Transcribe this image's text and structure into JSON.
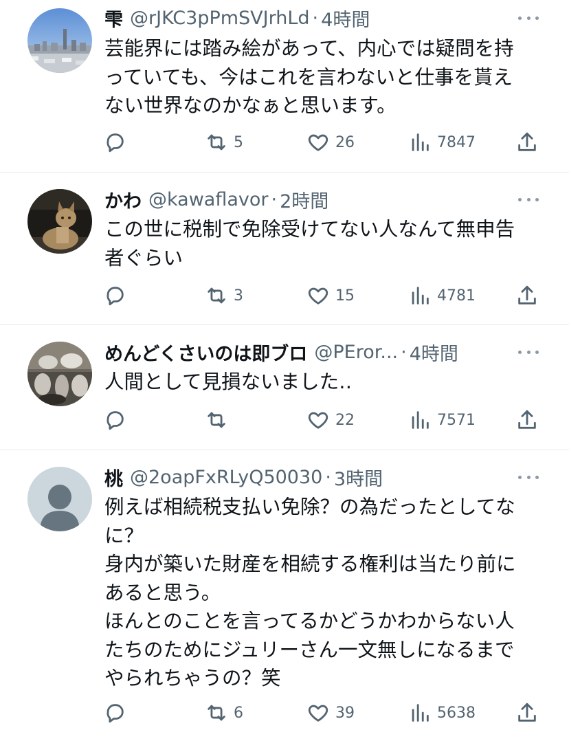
{
  "replies": [
    {
      "name": "雫",
      "handle": "@rJKC3pPmSVJrhLd",
      "time": "4時間",
      "avatar_icon": "cityscape-avatar",
      "text_lines": [
        "芸能界には踏み絵があって、内心では疑問を持",
        "っていても、今はこれを言わないと仕事を貰え",
        "ない世界なのかなぁと思います。"
      ],
      "retweets": "5",
      "likes": "26",
      "views": "7847"
    },
    {
      "name": "かわ",
      "handle": "@kawaflavor",
      "time": "2時間",
      "avatar_icon": "cat-avatar",
      "text_lines": [
        "この世に税制で免除受けてない人なんて無申告",
        "者ぐらい"
      ],
      "retweets": "3",
      "likes": "15",
      "views": "4781"
    },
    {
      "name": "めんどくさいのは即ブロ",
      "handle": "@PEror...",
      "time": "4時間",
      "avatar_icon": "glass-figurines-avatar",
      "text_lines": [
        "人間として見損ないました‥"
      ],
      "retweets": "",
      "likes": "22",
      "views": "7571"
    },
    {
      "name": "桃",
      "handle": "@2oapFxRLyQ50030",
      "time": "3時間",
      "avatar_icon": "default-person-avatar",
      "text_lines": [
        "例えば相続税支払い免除？の為だったとしてな",
        "に？",
        "身内が築いた財産を相続する権利は当たり前に",
        "あると思う。",
        "ほんとのことを言ってるかどうかわからない人",
        "たちのためにジュリーさん一文無しになるまで",
        "やられちゃうの？笑"
      ],
      "retweets": "6",
      "likes": "39",
      "views": "5638"
    }
  ],
  "colors": {
    "text": "#0f1419",
    "secondary": "#536471",
    "divider": "#e6e9ec",
    "default_avatar": "#ccd6dd"
  },
  "icons": {
    "reply": "reply-bubble-icon",
    "retweet": "retweet-icon",
    "like": "heart-icon",
    "views": "views-bar-icon",
    "share": "share-upload-icon",
    "more": "more-dots-icon"
  },
  "separator": "·"
}
